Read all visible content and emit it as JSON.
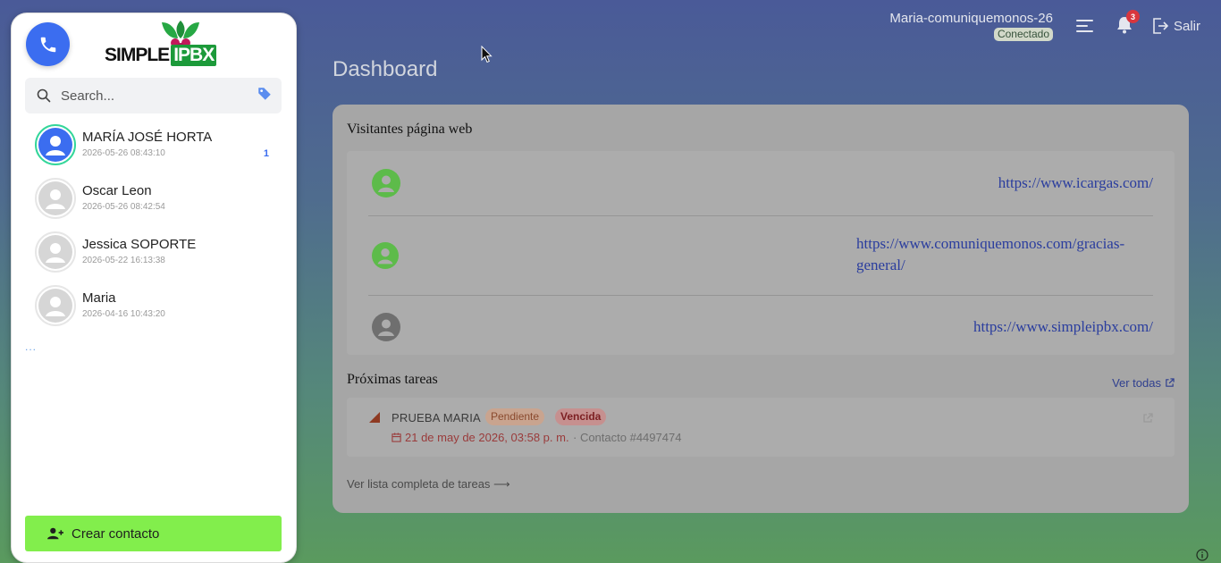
{
  "sidebar": {
    "logo": {
      "word1": "SIMPLE",
      "word2": "IPBX"
    },
    "search": {
      "placeholder": "Search..."
    },
    "contacts": [
      {
        "name": "MARÍA JOSÉ HORTA",
        "time": "2026-05-26 08:43:10",
        "unread": "1",
        "active": true
      },
      {
        "name": "Oscar Leon",
        "time": "2026-05-26 08:42:54"
      },
      {
        "name": "Jessica SOPORTE",
        "time": "2026-05-22 16:13:38"
      },
      {
        "name": "Maria",
        "time": "2026-04-16 10:43:20"
      }
    ],
    "more": "...",
    "create_label": "Crear contacto"
  },
  "header": {
    "user": "Maria-comuniquemonos-26",
    "status": "Conectado",
    "notifications": "3",
    "logout_label": "Salir"
  },
  "page_title": "Dashboard",
  "visitors": {
    "title": "Visitantes página web",
    "items": [
      {
        "url": "https://www.icargas.com/",
        "status": "online"
      },
      {
        "url": "https://www.comuniquemonos.com/gracias-general/",
        "status": "online"
      },
      {
        "url": "https://www.simpleipbx.com/",
        "status": "offline"
      }
    ]
  },
  "tasks": {
    "title": "Próximas tareas",
    "view_all": "Ver todas",
    "items": [
      {
        "title": "PRUEBA MARIA",
        "badge_pending": "Pendiente",
        "badge_overdue": "Vencida",
        "date": "21 de may de 2026, 03:58 p. m.",
        "contact": "· Contacto #4497474"
      }
    ],
    "full_list": "Ver lista completa de tareas ⟶"
  },
  "colors": {
    "accent_blue": "#3b6df0",
    "create_green": "#82ee4c",
    "online": "#5dbb4a",
    "offline": "#6f6f6f",
    "link": "#2a3d9e"
  }
}
